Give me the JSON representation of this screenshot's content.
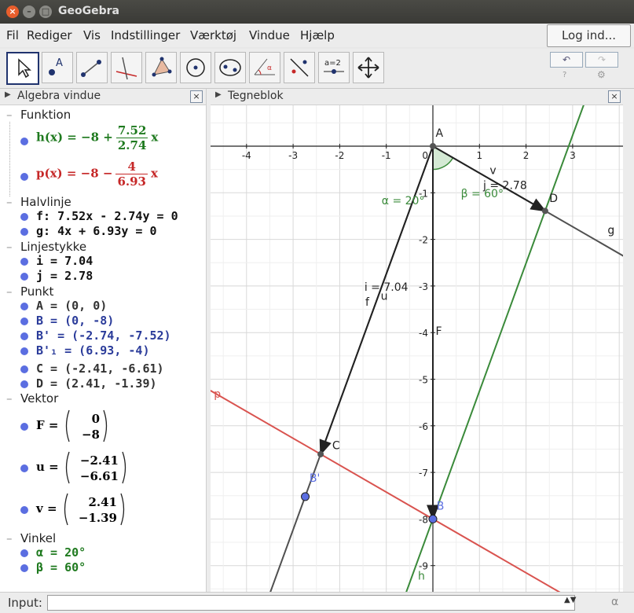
{
  "window": {
    "title": "GeoGebra"
  },
  "menu": [
    "Fil",
    "Rediger",
    "Vis",
    "Indstillinger",
    "Værktøj",
    "Vindue",
    "Hjælp"
  ],
  "login": "Log ind...",
  "toolbar": {
    "slider_label": "a=2",
    "undo": "↶",
    "redo": "↷",
    "help": "?",
    "settings": "⚙"
  },
  "algebra": {
    "title": "Algebra vindue",
    "categories": {
      "funktion": "Funktion",
      "halvlinje": "Halvlinje",
      "linjestykke": "Linjestykke",
      "punkt": "Punkt",
      "vektor": "Vektor",
      "vinkel": "Vinkel"
    },
    "h": {
      "lhs": "h(x) = −8 +",
      "num": "7.52",
      "den": "2.74",
      "var": "x",
      "color": "#1f7a1f"
    },
    "p": {
      "lhs": "p(x) = −8 −",
      "num": "4",
      "den": "6.93",
      "var": "x",
      "color": "#c62828"
    },
    "f": "f: 7.52x - 2.74y = 0",
    "g": "g: 4x + 6.93y = 0",
    "i": "i = 7.04",
    "j": "j = 2.78",
    "A": "A = (0, 0)",
    "B": "B = (0, -8)",
    "B1": "B' = (-2.74, -7.52)",
    "B2": "B'₁ = (6.93, -4)",
    "C": "C = (-2.41, -6.61)",
    "D": "D = (2.41, -1.39)",
    "F": {
      "name": "F",
      "top": "0",
      "bottom": "−8"
    },
    "u": {
      "name": "u",
      "top": "−2.41",
      "bottom": "−6.61"
    },
    "v": {
      "name": "v",
      "top": "2.41",
      "bottom": "−1.39"
    },
    "alpha": "α = 20°",
    "beta": "β = 60°"
  },
  "graphics": {
    "title": "Tegneblok",
    "x_ticks": [
      "-4",
      "-3",
      "-2",
      "-1",
      "1",
      "2",
      "3"
    ],
    "y_ticks": [
      "-1",
      "-2",
      "-3",
      "-4",
      "-5",
      "-6",
      "-7",
      "-8",
      "-9"
    ],
    "origin_label": "0",
    "labels": {
      "A": "A",
      "B": "B",
      "C": "C",
      "D": "D",
      "Bp": "B'",
      "f": "f",
      "g": "g",
      "h": "h",
      "p": "p",
      "F": "F",
      "u": "u",
      "v": "v",
      "i": "i = 7.04",
      "j": "j = 2.78",
      "alpha": "α = 20°",
      "beta": "β = 60°"
    },
    "colors": {
      "black": "#222222",
      "green": "#3a8a3a",
      "red": "#d9534f",
      "point": "#5b6ee1",
      "gray": "#505050"
    }
  },
  "input": {
    "label": "Input:",
    "value": "",
    "alpha": "α"
  }
}
